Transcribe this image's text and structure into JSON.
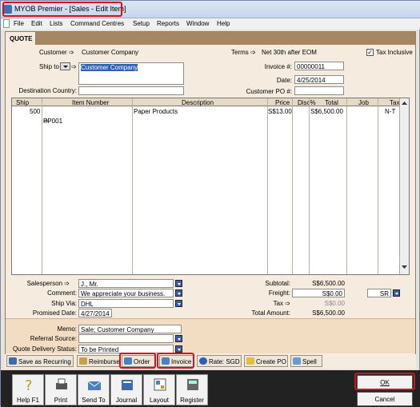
{
  "window": {
    "title": "MYOB Premier - [Sales - Edit Item]"
  },
  "menu": [
    "File",
    "Edit",
    "Lists",
    "Command Centres",
    "Setup",
    "Reports",
    "Window",
    "Help"
  ],
  "tab": "QUOTE",
  "header": {
    "customer_label": "Customer",
    "customer_value": "Customer Company",
    "terms_label": "Terms",
    "terms_value": "Net 30th after EOM",
    "tax_inclusive_label": "Tax Inclusive",
    "tax_inclusive_checked": "✓",
    "ship_to_label": "Ship to",
    "ship_to_value": "Customer Company",
    "destination_country_label": "Destination Country:",
    "destination_country_value": "",
    "invoice_label": "Invoice #:",
    "invoice_value": "00000011",
    "date_label": "Date:",
    "date_value": "4/25/2014",
    "customer_po_label": "Customer PO #:",
    "customer_po_value": ""
  },
  "columns": [
    "Ship",
    "Item Number",
    "Description",
    "Price",
    "Disc%",
    "Total",
    "Job",
    "Tax"
  ],
  "rows": [
    {
      "ship": "500",
      "item": "PP001",
      "description": "Paper Products",
      "price": "S$13.00",
      "disc": "",
      "total": "S$6,500.00",
      "job": "",
      "tax": "N-T"
    }
  ],
  "footer": {
    "salesperson_label": "Salesperson",
    "salesperson_value": "J., Mr.",
    "comment_label": "Comment:",
    "comment_value": "We appreciate your business.",
    "ship_via_label": "Ship Via:",
    "ship_via_value": "DHL",
    "promised_date_label": "Promised Date:",
    "promised_date_value": "4/27/2014",
    "subtotal_label": "Subtotal:",
    "subtotal_value": "S$6,500.00",
    "freight_label": "Freight:",
    "freight_value": "S$0.00",
    "freight_tax_code": "SR",
    "tax_label": "Tax",
    "tax_value": "S$0.00",
    "total_amount_label": "Total Amount:",
    "total_amount_value": "S$6,500.00",
    "memo_label": "Memo:",
    "memo_value": "Sale; Customer Company",
    "referral_source_label": "Referral Source:",
    "referral_source_value": "",
    "quote_delivery_label": "Quote Delivery Status:",
    "quote_delivery_value": "To be Printed"
  },
  "actions": {
    "save_recurring": "Save as Recurring",
    "reimburse": "Reimburse",
    "order": "Order",
    "invoice": "Invoice",
    "rate": "Rate: SGD",
    "create_po": "Create PO",
    "spell": "Spell"
  },
  "toolbar": {
    "help": "Help F1",
    "print": "Print",
    "send_to": "Send To",
    "journal": "Journal",
    "layout": "Layout",
    "register": "Register",
    "ok": "OK",
    "cancel": "Cancel"
  },
  "colors": {
    "highlight": "#d8101a",
    "tab_bar": "#a58764",
    "form_bg": "#f5ecdf"
  }
}
